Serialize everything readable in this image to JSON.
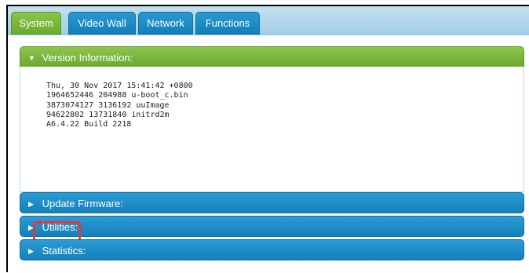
{
  "tabs": [
    {
      "label": "System",
      "active": true
    },
    {
      "label": "Video Wall",
      "active": false
    },
    {
      "label": "Network",
      "active": false
    },
    {
      "label": "Functions",
      "active": false
    }
  ],
  "sections": {
    "version": {
      "title": "Version Information:",
      "lines": [
        "Thu, 30 Nov 2017 15:41:42 +0800",
        "1964652446 204988 u-boot_c.bin",
        "3873074127 3136192 uuImage",
        "94622802 13731840 initrd2m",
        "A6.4.22 Build 2218"
      ]
    },
    "update_firmware": {
      "title": "Update Firmware:"
    },
    "utilities": {
      "title": "Utilities:"
    },
    "statistics": {
      "title": "Statistics:"
    }
  },
  "icons": {
    "expanded": "triangle-down-icon",
    "collapsed": "triangle-right-icon"
  },
  "colors": {
    "active_green": "#7ab83c",
    "tab_blue": "#1a8cc8",
    "highlight_red": "#e03a3a"
  }
}
